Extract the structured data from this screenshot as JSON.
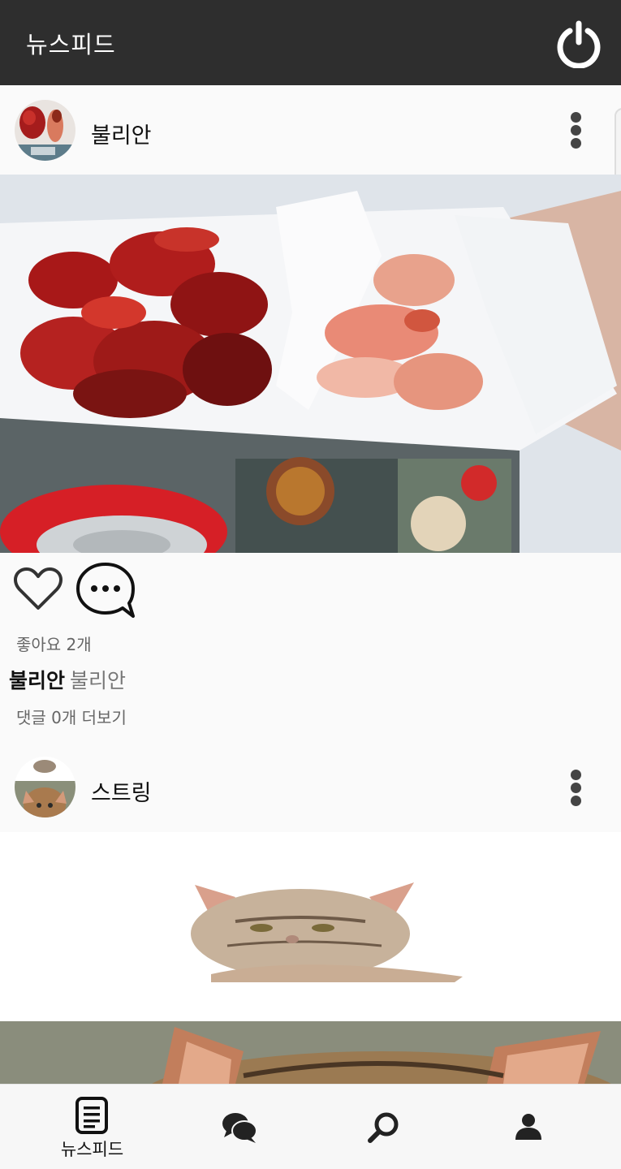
{
  "header": {
    "title": "뉴스피드",
    "power_icon": "power-icon"
  },
  "posts": [
    {
      "username": "불리안",
      "likes_text": "좋아요 2개",
      "caption_user": "불리안",
      "caption_text": "불리안",
      "comments_text": "댓글 0개 더보기"
    },
    {
      "username": "스트링"
    }
  ],
  "bottom_nav": {
    "items": [
      {
        "label": "뉴스피드",
        "icon": "newsfeed-icon",
        "active": true
      },
      {
        "label": "",
        "icon": "chat-icon"
      },
      {
        "label": "",
        "icon": "search-icon"
      },
      {
        "label": "",
        "icon": "profile-icon"
      }
    ]
  },
  "colors": {
    "appbar": "#2e2e2e",
    "background": "#fafafa",
    "text": "#111111",
    "muted": "#666666"
  }
}
